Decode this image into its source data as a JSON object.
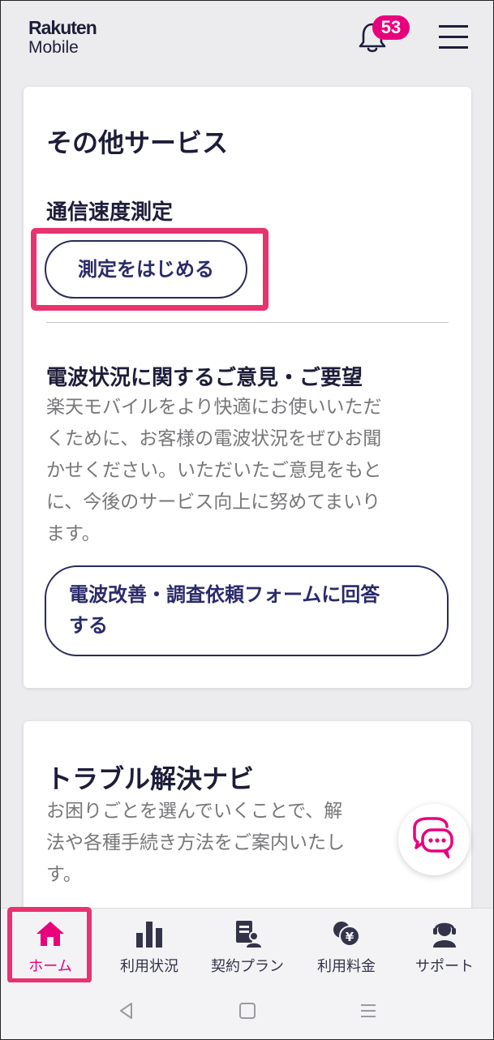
{
  "header": {
    "logo_line1": "Rakuten",
    "logo_line2": "Mobile",
    "notification_count": "53"
  },
  "other_services": {
    "title": "その他サービス",
    "speed_test": {
      "heading": "通信速度測定",
      "button_label": "測定をはじめる"
    },
    "feedback": {
      "heading": "電波状況に関するご意見・ご要望",
      "description_lines": [
        "楽天モバイルをより快適にお使いいただ",
        "くために、お客様の電波状況をぜひお聞",
        "かせください。いただいたご意見をもと",
        "に、今後のサービス向上に努めてまいり",
        "ます。"
      ],
      "button_lines": [
        "電波改善・調査依頼フォームに回答",
        "する"
      ]
    }
  },
  "trouble_navi": {
    "title": "トラブル解決ナビ",
    "description_lines": [
      "お困りごとを選んでいくことで、解",
      "法や各種手続き方法をご案内いたし",
      "す。"
    ]
  },
  "tabs": [
    {
      "label": "ホーム",
      "icon": "home-icon"
    },
    {
      "label": "利用状況",
      "icon": "bar-chart-icon"
    },
    {
      "label": "契約プラン",
      "icon": "contract-icon"
    },
    {
      "label": "利用料金",
      "icon": "yen-coin-icon"
    },
    {
      "label": "サポート",
      "icon": "support-agent-icon"
    }
  ],
  "colors": {
    "accent": "#e8007c",
    "highlight": "#e8336e",
    "text_dark": "#1d1d3a",
    "button_text": "#2a2a6a"
  }
}
